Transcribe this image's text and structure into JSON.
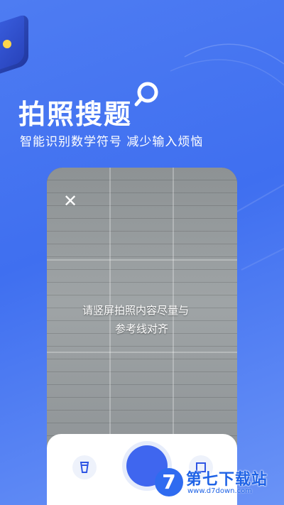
{
  "headline": "拍照搜题",
  "subtitle": "智能识别数学符号  减少输入烦恼",
  "camera": {
    "close_glyph": "✕",
    "hint_line1": "请竖屏拍照内容尽量与",
    "hint_line2": "参考线对齐"
  },
  "watermark": {
    "logo_glyph": "7",
    "text": "第七下载站",
    "url": "www.d7down.com"
  },
  "colors": {
    "background": "#4e7cf2",
    "shutter": "#3f66ef",
    "accent_yellow": "#ffd54a"
  },
  "icons": [
    "search-icon",
    "close-icon",
    "gallery-icon",
    "shutter-icon",
    "crop-icon"
  ]
}
